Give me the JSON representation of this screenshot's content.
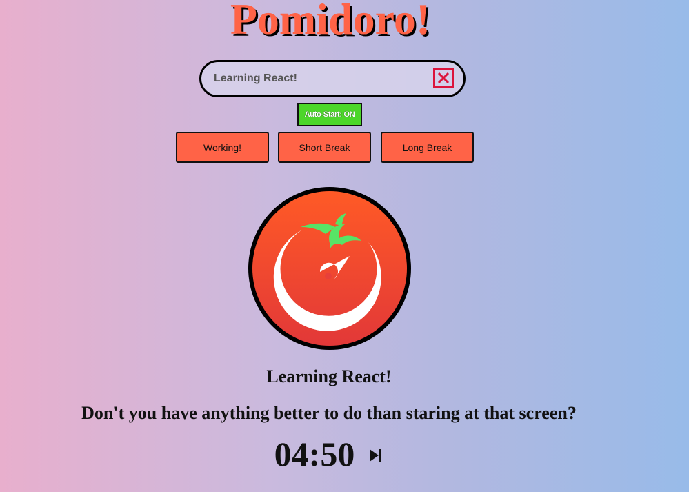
{
  "app": {
    "title": "Pomidoro!"
  },
  "task_input": {
    "value": "Learning React!",
    "clear_icon": "close-icon",
    "clear_color": "#dc143c"
  },
  "autostart": {
    "label": "Auto-Start: ON",
    "color": "#4cd62a"
  },
  "modes": [
    {
      "label": "Working!"
    },
    {
      "label": "Short Break"
    },
    {
      "label": "Long Break"
    }
  ],
  "mode_color": "#ff6347",
  "logo": {
    "icon": "tomato-timer-icon"
  },
  "current_task": "Learning React!",
  "message": "Don't you have anything better to do than staring at that screen?",
  "timer": {
    "display": "04:50",
    "skip_icon": "skip-next-icon"
  },
  "colors": {
    "accent": "#ff6347",
    "bg_left": "#e8afcd",
    "bg_right": "#98bbe9"
  }
}
